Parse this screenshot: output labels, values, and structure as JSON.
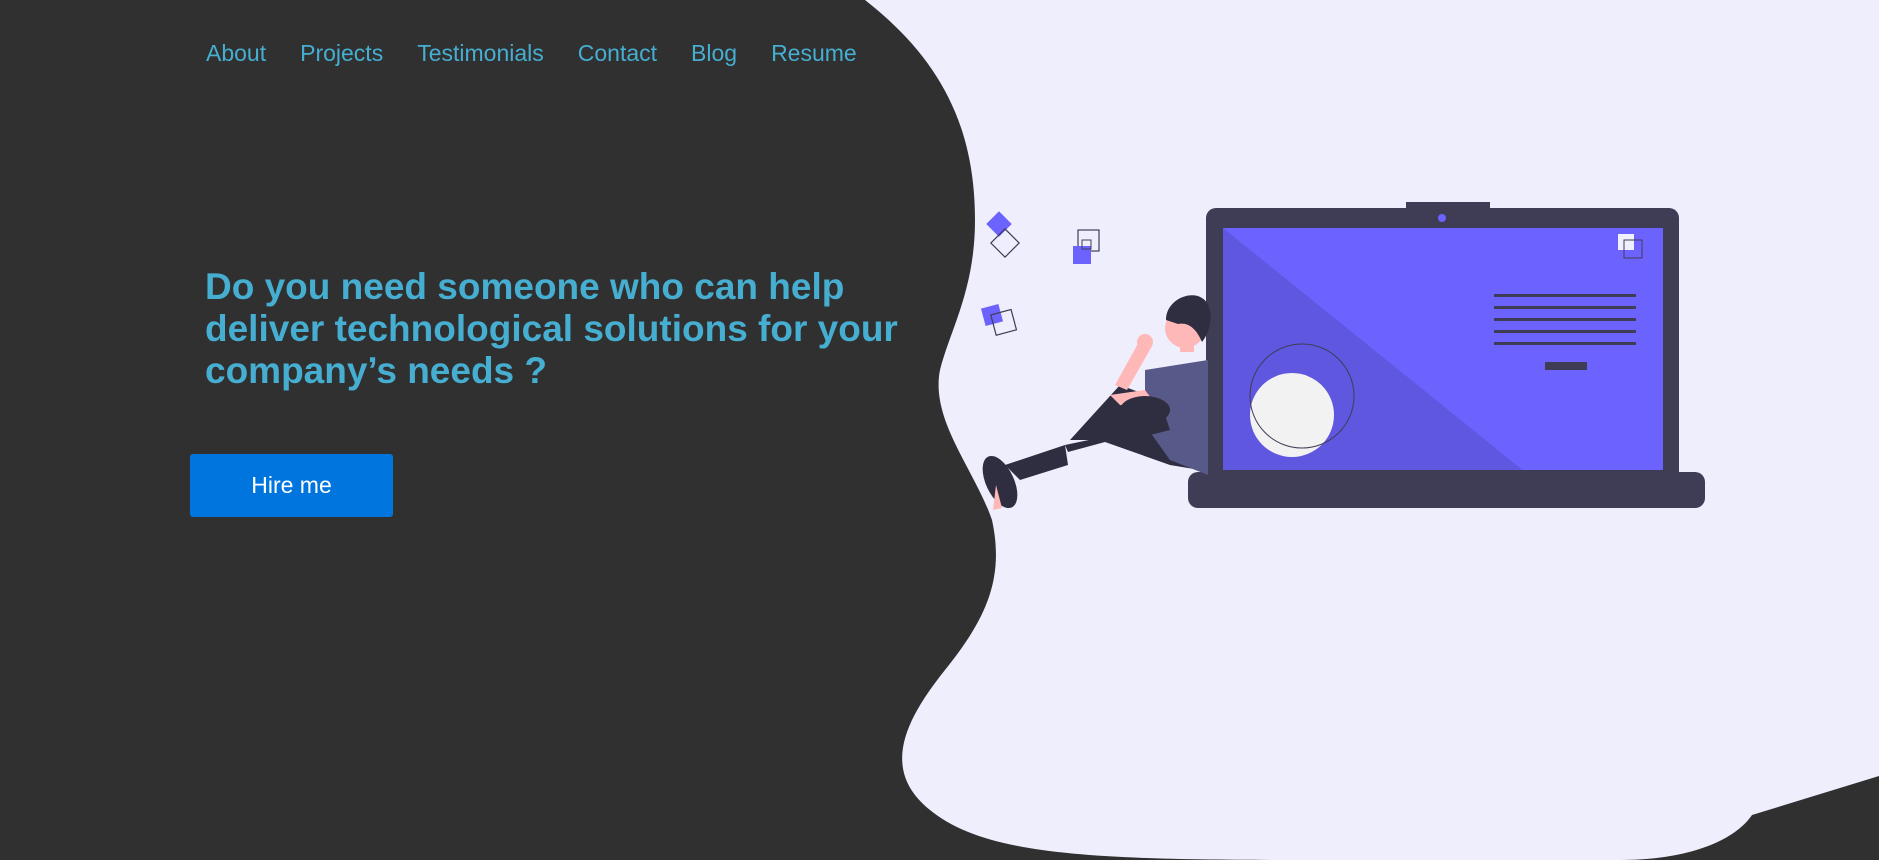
{
  "nav": {
    "items": [
      {
        "label": "About"
      },
      {
        "label": "Projects"
      },
      {
        "label": "Testimonials"
      },
      {
        "label": "Contact"
      },
      {
        "label": "Blog"
      },
      {
        "label": "Resume"
      }
    ]
  },
  "hero": {
    "title": "Do you need someone who can help deliver technological solutions for your company’s needs ?",
    "cta_label": "Hire me"
  },
  "colors": {
    "background_dark": "#303030",
    "background_light": "#efeefd",
    "accent_text": "#46aed1",
    "button": "#0075dd",
    "illustration_primary": "#6c63ff",
    "illustration_dark": "#3f3d56"
  },
  "illustration": {
    "name": "person-with-laptop-illustration"
  }
}
